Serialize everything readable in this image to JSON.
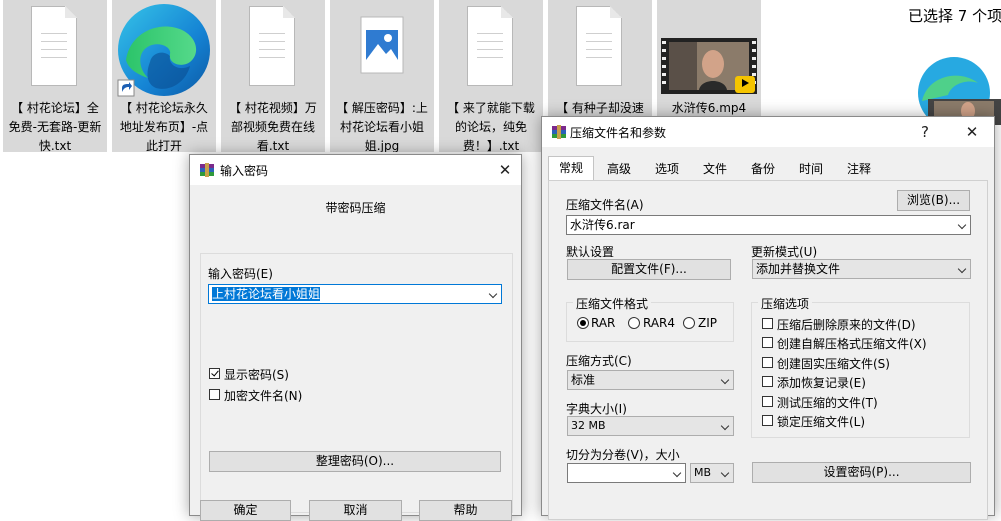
{
  "explorer": {
    "files": [
      {
        "name": "【 村花论坛】全免费-无套路-更新快.txt",
        "icon": "text-file-icon"
      },
      {
        "name": "【 村花论坛永久地址发布页】-点此打开",
        "icon": "edge-shortcut-icon"
      },
      {
        "name": "【 村花视频】万部视频免费在线看.txt",
        "icon": "text-file-icon"
      },
      {
        "name": "【 解压密码】:上村花论坛看小姐姐.jpg",
        "icon": "image-file-icon"
      },
      {
        "name": "【 来了就能下载的论坛，纯免费！】.txt",
        "icon": "text-file-icon"
      },
      {
        "name": "【 有种子却没速",
        "icon": "text-file-icon"
      },
      {
        "name": "水浒传6.mp4",
        "icon": "video-thumbnail"
      }
    ],
    "selection_status": "已选择 7 个项"
  },
  "password_dialog": {
    "title": "输入密码",
    "heading": "带密码压缩",
    "password_label": "输入密码(E)",
    "password_value": "上村花论坛看小姐姐",
    "show_password_label": "显示密码(S)",
    "show_password_checked": true,
    "encrypt_names_label": "加密文件名(N)",
    "encrypt_names_checked": false,
    "organize_button": "整理密码(O)...",
    "ok_button": "确定",
    "cancel_button": "取消",
    "help_button": "帮助",
    "close_icon": "close-icon"
  },
  "archive_dialog": {
    "title": "压缩文件名和参数",
    "help_glyph": "?",
    "tabs": [
      "常规",
      "高级",
      "选项",
      "文件",
      "备份",
      "时间",
      "注释"
    ],
    "active_tab": "常规",
    "archive_name_label": "压缩文件名(A)",
    "browse_button": "浏览(B)...",
    "archive_name_value": "水浒传6.rar",
    "default_settings_label": "默认设置",
    "profiles_button": "配置文件(F)...",
    "update_mode_label": "更新模式(U)",
    "update_mode_value": "添加并替换文件",
    "format_group_title": "压缩文件格式",
    "formats": [
      {
        "label": "RAR",
        "selected": true
      },
      {
        "label": "RAR4",
        "selected": false
      },
      {
        "label": "ZIP",
        "selected": false
      }
    ],
    "method_label": "压缩方式(C)",
    "method_value": "标准",
    "dict_label": "字典大小(I)",
    "dict_value": "32 MB",
    "split_label": "切分为分卷(V)，大小",
    "split_value": "",
    "split_unit": "MB",
    "options_group_title": "压缩选项",
    "options": [
      {
        "label": "压缩后删除原来的文件(D)",
        "checked": false
      },
      {
        "label": "创建自解压格式压缩文件(X)",
        "checked": false
      },
      {
        "label": "创建固实压缩文件(S)",
        "checked": false
      },
      {
        "label": "添加恢复记录(E)",
        "checked": false
      },
      {
        "label": "测试压缩的文件(T)",
        "checked": false
      },
      {
        "label": "锁定压缩文件(L)",
        "checked": false
      }
    ],
    "set_password_button": "设置密码(P)..."
  },
  "colors": {
    "tile_bg": "#d9d9d9",
    "dialog_bg": "#f0f0f0",
    "selection_blue": "#0078d7"
  }
}
